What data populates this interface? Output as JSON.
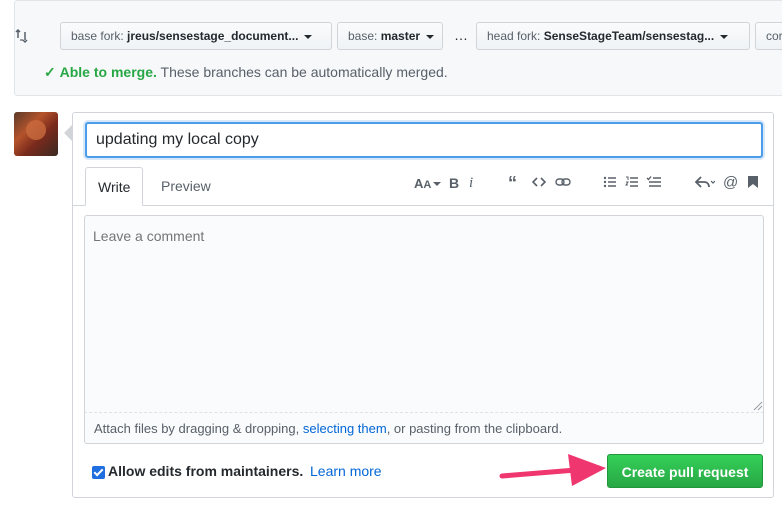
{
  "compare": {
    "base_fork_prefix": "base fork: ",
    "base_fork_value": "jreus/sensestage_document...",
    "base_prefix": "base: ",
    "base_value": "master",
    "ellipsis": "…",
    "head_fork_prefix": "head fork: ",
    "head_fork_value": "SenseStageTeam/sensestag...",
    "compare_prefix": "cor",
    "merge_status": "Able to merge.",
    "merge_message": "These branches can be automatically merged."
  },
  "form": {
    "title_value": "updating my local copy",
    "tabs": [
      "Write",
      "Preview"
    ],
    "comment_placeholder": "Leave a comment",
    "attach_prefix": "Attach files by dragging & dropping, ",
    "attach_link": "selecting them",
    "attach_suffix": ", or pasting from the clipboard.",
    "allow_edits_label": "Allow edits from maintainers.",
    "learn_more": "Learn more",
    "submit_label": "Create pull request"
  },
  "toolbar_icons": [
    "header-icon",
    "bold-icon",
    "italic-icon",
    "quote-icon",
    "code-icon",
    "link-icon",
    "unordered-list-icon",
    "ordered-list-icon",
    "task-list-icon",
    "reply-icon",
    "mention-icon",
    "bookmark-icon"
  ],
  "colors": {
    "success": "#28a745",
    "link": "#0366d6",
    "focus": "#4b9fe8",
    "arrow": "#f0366f"
  }
}
